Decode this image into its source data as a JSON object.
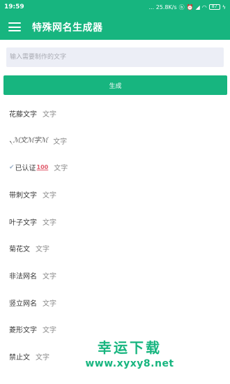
{
  "status_bar": {
    "time": "19:59",
    "network_speed": "... 25.8K/s",
    "battery_level": "87"
  },
  "app_bar": {
    "title": "特殊网名生成器"
  },
  "input": {
    "placeholder": "输入需要制作的文字",
    "value": ""
  },
  "generate_button": {
    "label": "生成"
  },
  "styles": [
    {
      "name": "花藤文字",
      "sample": "文字"
    },
    {
      "name": "৲ℳ文ℳ字ℳ",
      "sample": "文字"
    },
    {
      "name": "已认证",
      "badge": "100",
      "sample": "文字"
    },
    {
      "name": "带刺文字",
      "sample": "文字"
    },
    {
      "name": "叶子文字",
      "sample": "文字"
    },
    {
      "name": "菊花文",
      "sample": "文字"
    },
    {
      "name": "非法网名",
      "sample": "文字"
    },
    {
      "name": "竖立网名",
      "sample": "文字"
    },
    {
      "name": "菱形文字",
      "sample": "文字"
    },
    {
      "name": "禁止文",
      "sample": "文字"
    }
  ],
  "watermark": {
    "title": "幸运下载",
    "url": "www.xyxy8.net"
  },
  "colors": {
    "primary": "#17b57f",
    "input_bg": "#eceef6"
  }
}
